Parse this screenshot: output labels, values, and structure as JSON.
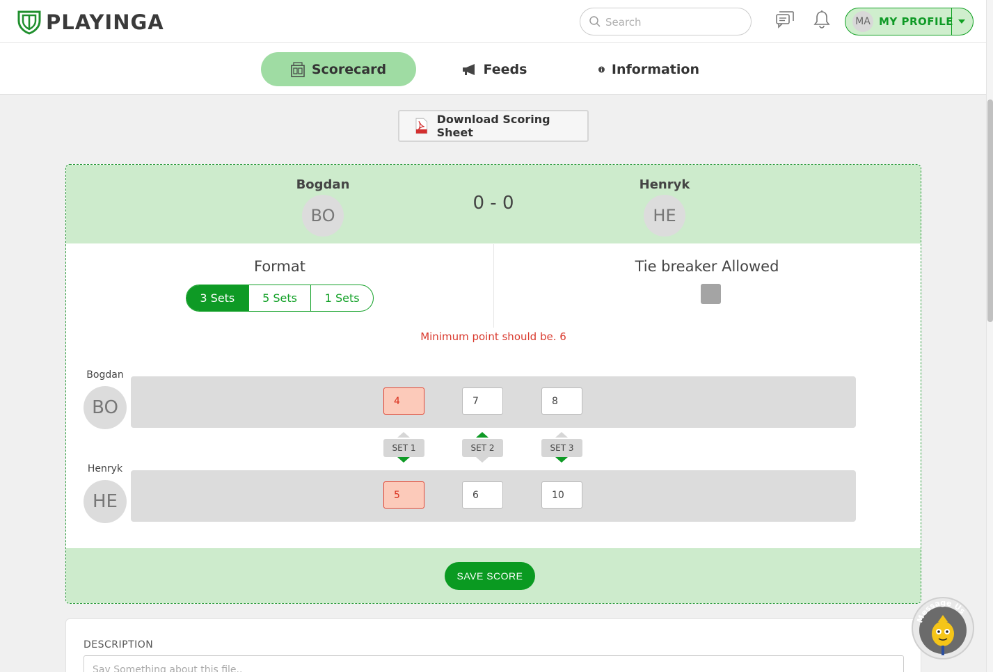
{
  "header": {
    "logo_text": "PLAYINGA",
    "search_placeholder": "Search",
    "profile_initials": "MA",
    "profile_label": "MY PROFILE"
  },
  "tabs": [
    {
      "label": "Scorecard",
      "active": true
    },
    {
      "label": "Feeds",
      "active": false
    },
    {
      "label": "Information",
      "active": false
    }
  ],
  "download_label": "Download Scoring Sheet",
  "match": {
    "player1": {
      "name": "Bogdan",
      "initials": "BO"
    },
    "player2": {
      "name": "Henryk",
      "initials": "HE"
    },
    "score": "0 - 0"
  },
  "format": {
    "title": "Format",
    "options": [
      "3 Sets",
      "5 Sets",
      "1 Sets"
    ],
    "selected": "3 Sets"
  },
  "tiebreaker": {
    "title": "Tie breaker Allowed",
    "checked": false
  },
  "error_message": "Minimum point should be. 6",
  "sets": [
    {
      "label": "SET 1",
      "player1": "4",
      "player2": "5",
      "error": true,
      "winner": "player2"
    },
    {
      "label": "SET 2",
      "player1": "7",
      "player2": "6",
      "error": false,
      "winner": "player1"
    },
    {
      "label": "SET 3",
      "player1": "8",
      "player2": "10",
      "error": false,
      "winner": "player2"
    }
  ],
  "save_label": "SAVE SCORE",
  "description": {
    "label": "DESCRIPTION",
    "placeholder": "Say Something about this file.."
  },
  "message_us": "Message Us",
  "colors": {
    "brand_green": "#0e9a25",
    "light_green": "#cdebcc",
    "error_red": "#d93a2e"
  }
}
